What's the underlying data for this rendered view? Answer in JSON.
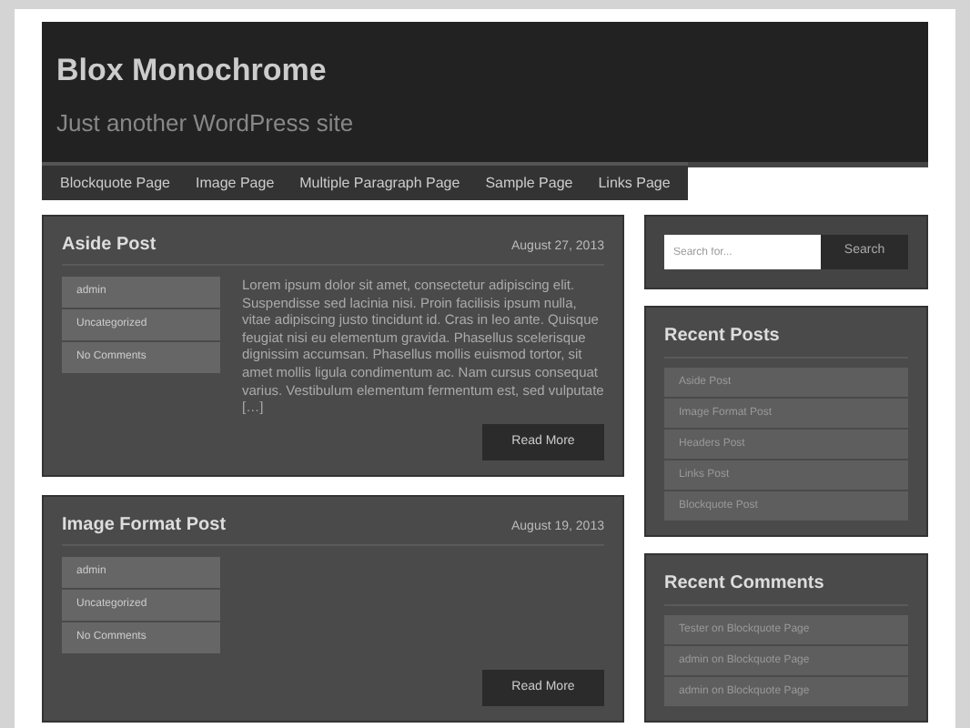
{
  "site": {
    "title": "Blox Monochrome",
    "tagline": "Just another WordPress site"
  },
  "nav": [
    {
      "label": "Blockquote Page"
    },
    {
      "label": "Image Page"
    },
    {
      "label": "Multiple Paragraph Page"
    },
    {
      "label": "Sample Page"
    },
    {
      "label": "Links Page"
    }
  ],
  "posts": [
    {
      "title": "Aside Post",
      "date": "August 27, 2013",
      "meta": [
        "admin",
        "Uncategorized",
        "No Comments"
      ],
      "excerpt": "Lorem ipsum dolor sit amet, consectetur adipiscing elit. Suspendisse sed lacinia nisi. Proin facilisis ipsum nulla, vitae adipiscing justo tincidunt id. Cras in leo ante. Quisque feugiat nisi eu elementum gravida. Phasellus scelerisque dignissim accumsan. Phasellus mollis euismod tortor, sit amet mollis ligula condimentum ac. Nam cursus consequat varius. Vestibulum elementum fermentum est, sed vulputate […]",
      "button": "Read More"
    },
    {
      "title": "Image Format Post",
      "date": "August 19, 2013",
      "meta": [
        "admin",
        "Uncategorized",
        "No Comments"
      ],
      "button": "Read More"
    }
  ],
  "search": {
    "placeholder": "Search for...",
    "button": "Search"
  },
  "widgets": [
    {
      "title": "Recent Posts",
      "items": [
        "Aside Post",
        "Image Format Post",
        "Headers Post",
        "Links Post",
        "Blockquote Post"
      ]
    },
    {
      "title": "Recent Comments",
      "items": [
        "Tester on Blockquote Page",
        "admin on Blockquote Page",
        "admin on Blockquote Page"
      ]
    }
  ]
}
